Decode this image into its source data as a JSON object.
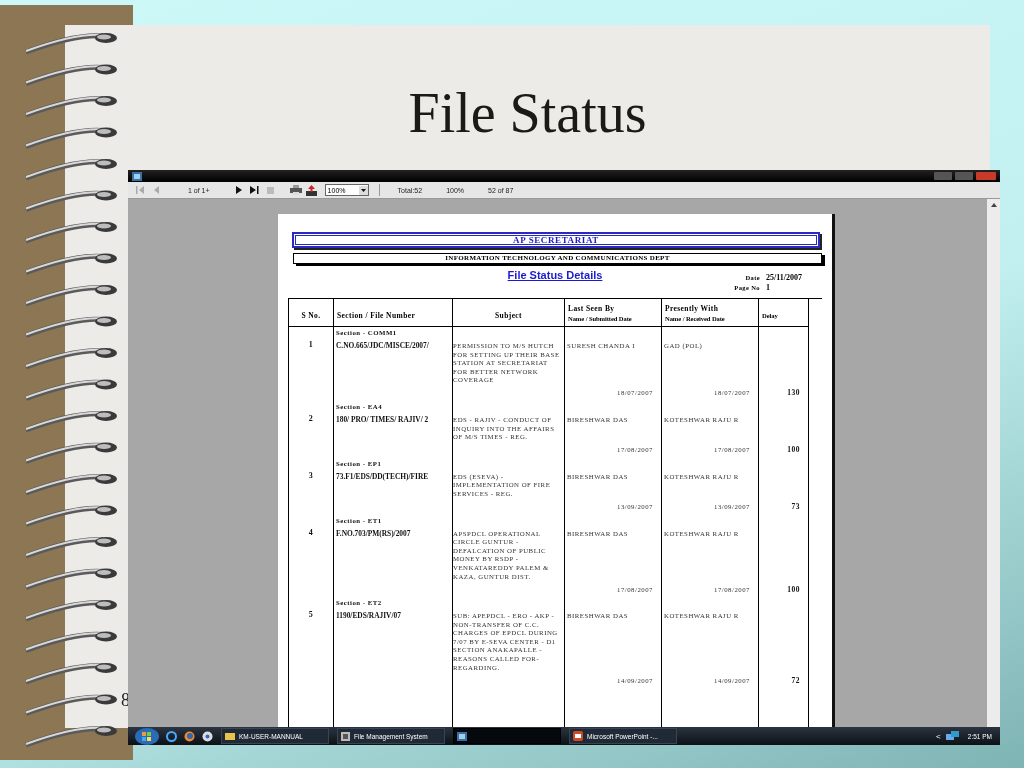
{
  "slide": {
    "title": "File Status",
    "number": "8"
  },
  "window": {
    "toolbar": {
      "page": "1 of 1+",
      "zoom": "100%",
      "total": "Total:52",
      "percent": "100%",
      "records": "52 of 87"
    }
  },
  "report": {
    "heading": "AP SECRETARIAT",
    "department": "INFORMATION TECHNOLOGY AND COMMUNICATIONS DEPT",
    "title": "File Status Details",
    "date_label": "Date",
    "date": "25/11/2007",
    "page_label": "Page No",
    "page": "1",
    "columns": [
      {
        "label": "S No."
      },
      {
        "label": "Section / File Number"
      },
      {
        "label": "Subject"
      },
      {
        "label": "Last Seen By",
        "sublabel": "Name / Submitted Date"
      },
      {
        "label": "Presently With",
        "sublabel": "Name / Received Date"
      },
      {
        "sublabel": "Delay"
      }
    ],
    "rows": [
      {
        "section": "Section - COMM1",
        "sno": "1",
        "file_number": "C.NO.665/JDC/MISCE/2007/",
        "subject": "PERMISSION TO M/S HUTCH FOR SETTING UP THEIR BASE STATION AT SECRETARIAT FOR BETTER NETWORK COVERAGE",
        "last_seen_by": "SURESH CHANDA I",
        "submitted_date": "18/07/2007",
        "presently_with": "GAD (POL)",
        "received_date": "18/07/2007",
        "delay": "130"
      },
      {
        "section": "Section - EA4",
        "sno": "2",
        "file_number": "180/ PRO/ TIMES/ RAJIV/ 2",
        "subject": "EDS - RAJIV - CONDUCT OF INQUIRY INTO THE AFFAIRS OF M/S TIMES - REG.",
        "last_seen_by": "BIRESHWAR DAS",
        "submitted_date": "17/08/2007",
        "presently_with": "KOTESHWAR RAJU R",
        "received_date": "17/08/2007",
        "delay": "100"
      },
      {
        "section": "Section - EP1",
        "sno": "3",
        "file_number": "73.F1/EDS/DD(TECH)/FIRE",
        "subject": "EDS (ESEVA) - IMPLEMENTATION OF FIRE SERVICES - REG.",
        "last_seen_by": "BIRESHWAR DAS",
        "submitted_date": "13/09/2007",
        "presently_with": "KOTESHWAR RAJU R",
        "received_date": "13/09/2007",
        "delay": "73"
      },
      {
        "section": "Section - ET1",
        "sno": "4",
        "file_number": "F.NO.703/PM(RS)/2007",
        "subject": "APSPDCL OPERATIONAL CIRCLE GUNTUR - DEFALCATION OF PUBLIC MONEY BY RSDP - VENKATAREDDY PALEM & KAZA, GUNTUR DIST.",
        "last_seen_by": "BIRESHWAR DAS",
        "submitted_date": "17/08/2007",
        "presently_with": "KOTESHWAR RAJU R",
        "received_date": "17/08/2007",
        "delay": "100"
      },
      {
        "section": "Section - ET2",
        "sno": "5",
        "file_number": "1190/EDS/RAJIV/07",
        "subject": "SUB: APEPDCL - ERO - AKP - NON-TRANSFER OF C.C. CHARGES OF EPDCL DURING 7/07 BY E-SEVA CENTER - D1 SECTION ANAKAPALLE - REASONS CALLED FOR-REGARDING.",
        "last_seen_by": "BIRESHWAR DAS",
        "submitted_date": "14/09/2007",
        "presently_with": "KOTESHWAR RAJU R",
        "received_date": "14/09/2007",
        "delay": "72"
      }
    ]
  },
  "taskbar": {
    "buttons": [
      {
        "kind": "folder",
        "label": "KM-USER-MANNUAL",
        "selected": false
      },
      {
        "kind": "app",
        "label": "File Management System",
        "selected": false
      },
      {
        "kind": "report",
        "selected": true
      },
      {
        "kind": "powerpoint",
        "label": "Microsoft PowerPoint -...",
        "selected": false
      }
    ],
    "tray_arrow": "<",
    "clock": "2:51 PM"
  }
}
